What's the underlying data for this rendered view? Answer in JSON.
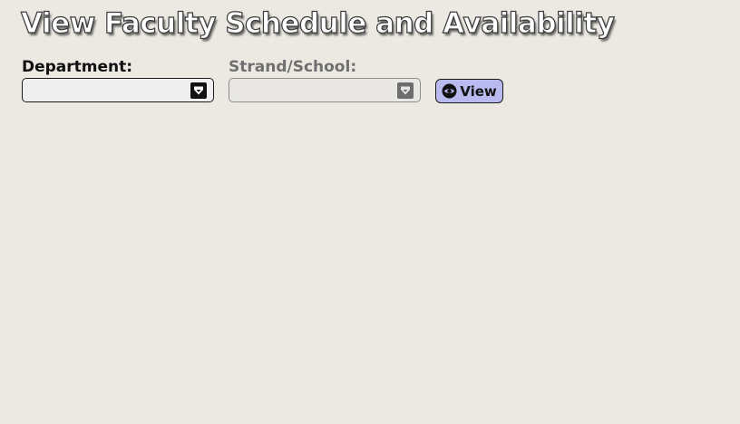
{
  "page": {
    "title": "View Faculty Schedule and Availability"
  },
  "filters": {
    "department": {
      "label": "Department:",
      "value": "",
      "icon": "dropdown-arrow-icon"
    },
    "strand": {
      "label": "Strand/School:",
      "value": "",
      "disabled": true,
      "icon": "dropdown-arrow-icon"
    }
  },
  "actions": {
    "view_label": "View",
    "view_icon": "eye-icon"
  },
  "colors": {
    "background": "#ece9e2",
    "button_bg": "#b9bbf0",
    "text_primary": "#111111",
    "text_disabled": "#6f6f6f"
  }
}
